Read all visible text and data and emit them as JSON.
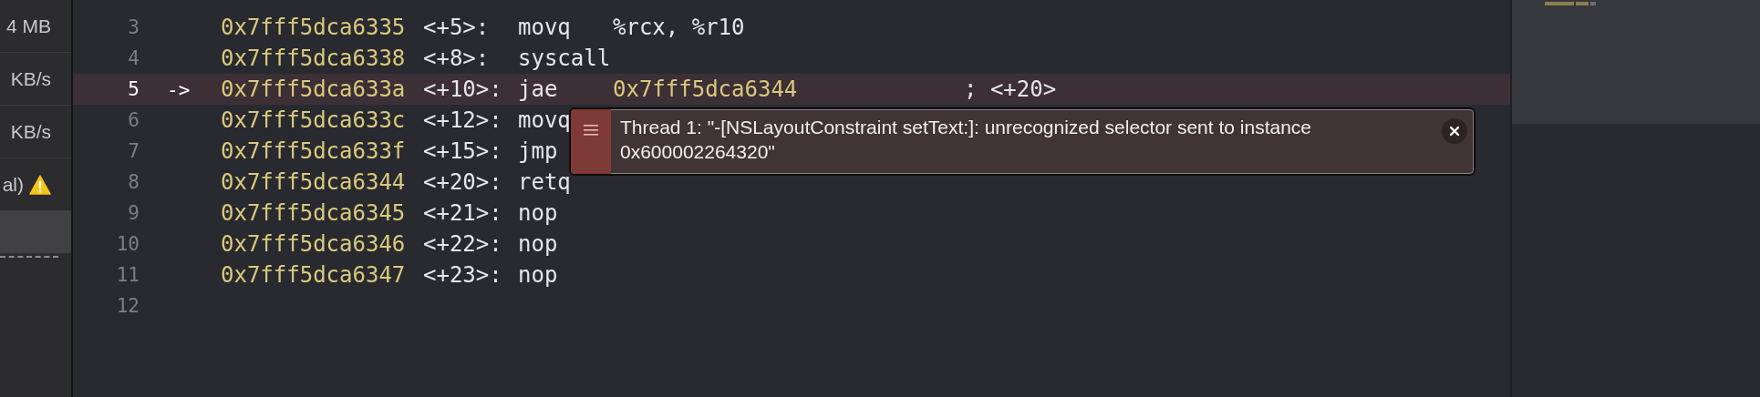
{
  "sidebar": {
    "items": [
      {
        "label": "4 MB",
        "warning": false,
        "selected": false
      },
      {
        "label": "KB/s",
        "warning": false,
        "selected": false
      },
      {
        "label": "KB/s",
        "warning": false,
        "selected": false
      },
      {
        "label": "al)",
        "warning": true,
        "selected": false
      },
      {
        "selected": true
      }
    ]
  },
  "disassembly": {
    "lines": [
      {
        "number": "3",
        "current": false,
        "address": "0x7fff5dca6335",
        "offset": "<+5>:",
        "mnemonic": "movq",
        "operands": "%rcx, %r10",
        "address_operand": false
      },
      {
        "number": "4",
        "current": false,
        "address": "0x7fff5dca6338",
        "offset": "<+8>:",
        "mnemonic": "syscall"
      },
      {
        "number": "5",
        "current": true,
        "arrow": "->",
        "address": "0x7fff5dca633a",
        "offset": "<+10>:",
        "mnemonic": "jae",
        "operands": "0x7fff5dca6344",
        "address_operand": true,
        "comment": "; <+20>"
      },
      {
        "number": "6",
        "current": false,
        "address": "0x7fff5dca633c",
        "offset": "<+12>:",
        "mnemonic": "movq"
      },
      {
        "number": "7",
        "current": false,
        "address": "0x7fff5dca633f",
        "offset": "<+15>:",
        "mnemonic": "jmp"
      },
      {
        "number": "8",
        "current": false,
        "address": "0x7fff5dca6344",
        "offset": "<+20>:",
        "mnemonic": "retq"
      },
      {
        "number": "9",
        "current": false,
        "address": "0x7fff5dca6345",
        "offset": "<+21>:",
        "mnemonic": "nop"
      },
      {
        "number": "10",
        "current": false,
        "address": "0x7fff5dca6346",
        "offset": "<+22>:",
        "mnemonic": "nop"
      },
      {
        "number": "11",
        "current": false,
        "address": "0x7fff5dca6347",
        "offset": "<+23>:",
        "mnemonic": "nop"
      },
      {
        "number": "12",
        "current": false
      }
    ]
  },
  "error_banner": {
    "message": "Thread 1: \"-[NSLayoutConstraint setText:]: unrecognized selector sent to instance 0x600002264320\""
  }
}
